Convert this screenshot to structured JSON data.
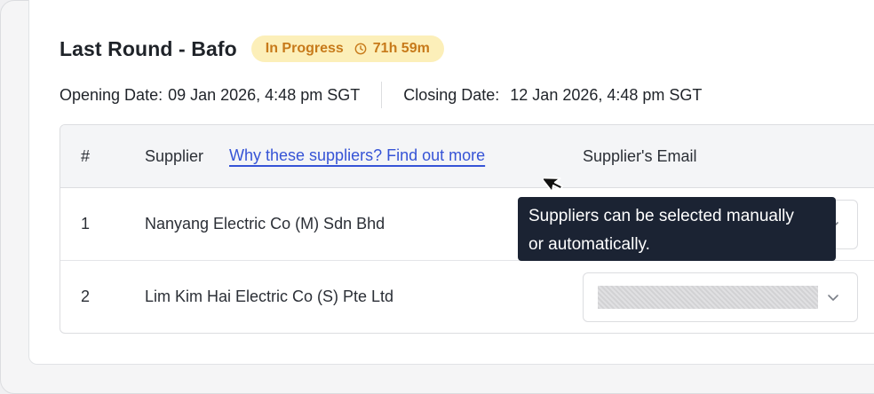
{
  "round": {
    "title": "Last Round - Bafo",
    "status": "In Progress",
    "time_remaining": "71h 59m",
    "opening_label": "Opening Date:",
    "opening_value": "09 Jan 2026, 4:48 pm SGT",
    "closing_label": "Closing Date:",
    "closing_value": "12 Jan 2026, 4:48 pm SGT"
  },
  "table": {
    "columns": {
      "index": "#",
      "supplier": "Supplier",
      "supplier_help_link": "Why these suppliers? Find out more",
      "email": "Supplier's Email"
    },
    "rows": [
      {
        "index": "1",
        "supplier": "Nanyang Electric Co (M) Sdn Bhd"
      },
      {
        "index": "2",
        "supplier": "Lim Kim Hai Electric Co (S) Pte Ltd"
      }
    ]
  },
  "tooltip": {
    "line1": "Suppliers can be selected manually",
    "line2": "or automatically."
  },
  "icons": {
    "badge": "clock-icon",
    "select": "chevron-down-icon",
    "pointer": "mouse-cursor-icon"
  },
  "colors": {
    "badge_bg": "#fcefb9",
    "badge_text": "#c77a1a",
    "link": "#3654d6",
    "tooltip_bg": "#1b2333"
  }
}
